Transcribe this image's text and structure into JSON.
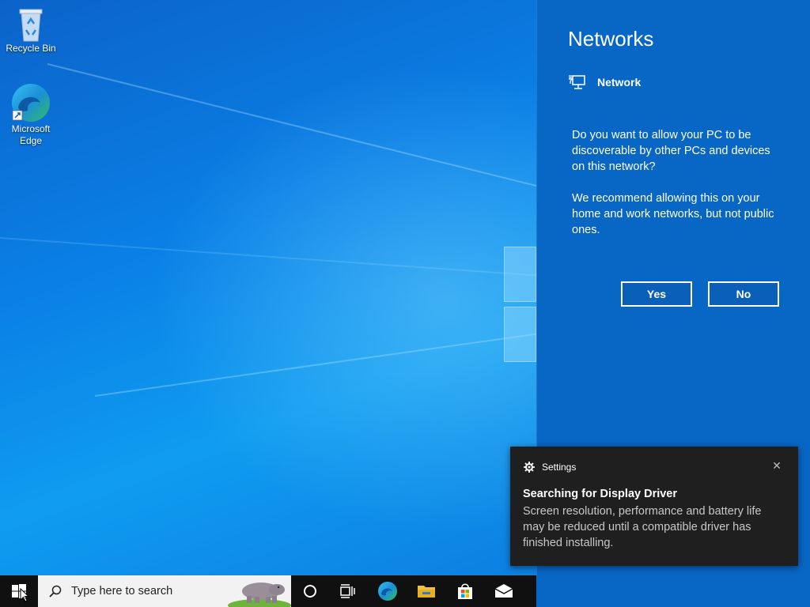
{
  "desktop": {
    "icons": [
      {
        "label": "Recycle Bin",
        "icon": "recycle-bin-icon"
      },
      {
        "label": "Microsoft Edge",
        "icon": "edge-icon"
      }
    ]
  },
  "network_panel": {
    "title": "Networks",
    "network_name": "Network",
    "network_icon": "ethernet-icon",
    "question": "Do you want to allow your PC to be discoverable by other PCs and devices on this network?",
    "recommendation": "We recommend allowing this on your home and work networks, but not public ones.",
    "yes_label": "Yes",
    "no_label": "No",
    "background": "#0866c4"
  },
  "toast": {
    "app_name": "Settings",
    "app_icon": "gear-icon",
    "title": "Searching for Display Driver",
    "body": "Screen resolution, performance and battery life may be reduced until a compatible driver has finished installing.",
    "close_icon": "close-icon"
  },
  "taskbar": {
    "search_placeholder": "Type here to search",
    "apps": [
      {
        "name": "cortana",
        "icon": "cortana-circle-icon"
      },
      {
        "name": "task-view",
        "icon": "task-view-icon"
      },
      {
        "name": "edge",
        "icon": "edge-icon"
      },
      {
        "name": "file-explorer",
        "icon": "folder-icon"
      },
      {
        "name": "store",
        "icon": "store-icon"
      },
      {
        "name": "mail",
        "icon": "mail-icon"
      }
    ]
  }
}
